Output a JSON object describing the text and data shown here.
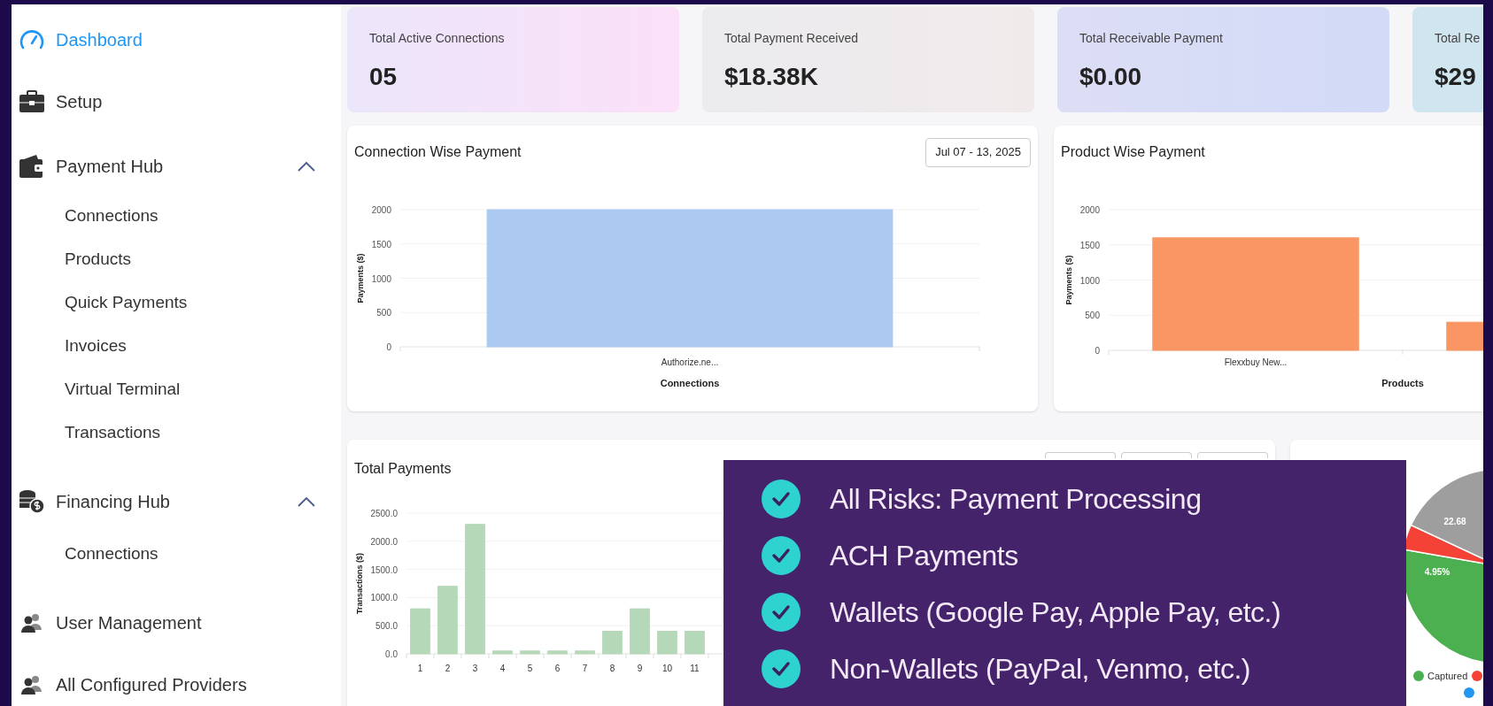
{
  "sidebar": {
    "items": [
      {
        "kind": "link",
        "label": "Dashboard",
        "selected": true
      },
      {
        "kind": "link",
        "label": "Setup",
        "selected": false
      },
      {
        "kind": "group",
        "label": "Payment Hub",
        "expanded": true,
        "children": [
          {
            "label": "Connections",
            "selected": false
          },
          {
            "label": "Products",
            "selected": false
          },
          {
            "label": "Quick Payments",
            "selected": false
          },
          {
            "label": "Invoices",
            "selected": false
          },
          {
            "label": "Virtual Terminal",
            "selected": false
          },
          {
            "label": "Transactions",
            "selected": false
          }
        ]
      },
      {
        "kind": "group",
        "label": "Financing Hub",
        "expanded": true,
        "children": [
          {
            "label": "Connections",
            "selected": false
          }
        ]
      },
      {
        "kind": "link",
        "label": "User Management",
        "selected": false
      },
      {
        "kind": "link",
        "label": "All Configured Providers",
        "selected": false
      }
    ]
  },
  "stats": [
    {
      "label": "Total Active Connections",
      "value": "05"
    },
    {
      "label": "Total Payment Received",
      "value": "$18.38K"
    },
    {
      "label": "Total Receivable Payment",
      "value": "$0.00"
    },
    {
      "label": "Total Re",
      "value": "$29"
    }
  ],
  "connection_chart": {
    "title": "Connection Wise Payment",
    "date_range": "Jul 07 - 13, 2025",
    "chart_data": {
      "type": "bar",
      "xlabel": "Connections",
      "ylabel": "Payments ($)",
      "categories": [
        "Authorize.ne..."
      ],
      "series": [
        {
          "color": "#b0cdf6",
          "values": [
            2000
          ]
        }
      ],
      "ylim": [
        0,
        2000
      ],
      "grid": true,
      "yticks": [
        0,
        500,
        1000,
        1500,
        2000
      ]
    }
  },
  "product_chart": {
    "title": "Product Wise Payment",
    "chart_data": {
      "type": "bar",
      "xlabel": "Products",
      "ylabel": "Payments ($)",
      "categories": [
        "Flexxbuy New...",
        null
      ],
      "series": [
        {
          "color": "#ff9966",
          "values": [
            1600,
            400
          ]
        }
      ],
      "ylim": [
        0,
        2000
      ],
      "grid": true,
      "yticks": [
        0,
        500,
        1000,
        1500,
        2000
      ]
    }
  },
  "total_payments": {
    "title": "Total Payments",
    "chart_data": {
      "type": "bar",
      "ylabel": "Transactions ($)",
      "categories": [
        "1",
        "2",
        "3",
        "4",
        "5",
        "6",
        "7",
        "8",
        "9",
        "10",
        "11"
      ],
      "series": [
        {
          "color": "#b9dcbc",
          "values": [
            800,
            1200,
            2300,
            50,
            50,
            50,
            50,
            400,
            800,
            400,
            400
          ]
        }
      ],
      "ylim": [
        0,
        2500
      ],
      "grid": true,
      "yticks": [
        {
          "value": 0,
          "label": "0.0"
        },
        {
          "value": 500,
          "label": "500.0"
        },
        {
          "value": 1000,
          "label": "1000.0"
        },
        {
          "value": 1500,
          "label": "1500.0"
        },
        {
          "value": 2000,
          "label": "2000.0"
        },
        {
          "value": 2500,
          "label": "2500.0"
        }
      ]
    }
  },
  "transactions": {
    "slice_labels": [
      "22.68",
      "4.95%"
    ],
    "legend": [
      {
        "label": "Captured",
        "color": "#4caf50"
      }
    ]
  },
  "promo": {
    "items": [
      "All Risks: Payment Processing",
      "ACH Payments",
      "Wallets (Google Pay, Apple Pay, etc.)",
      "Non-Wallets (PayPal, Venmo, etc.)"
    ]
  }
}
